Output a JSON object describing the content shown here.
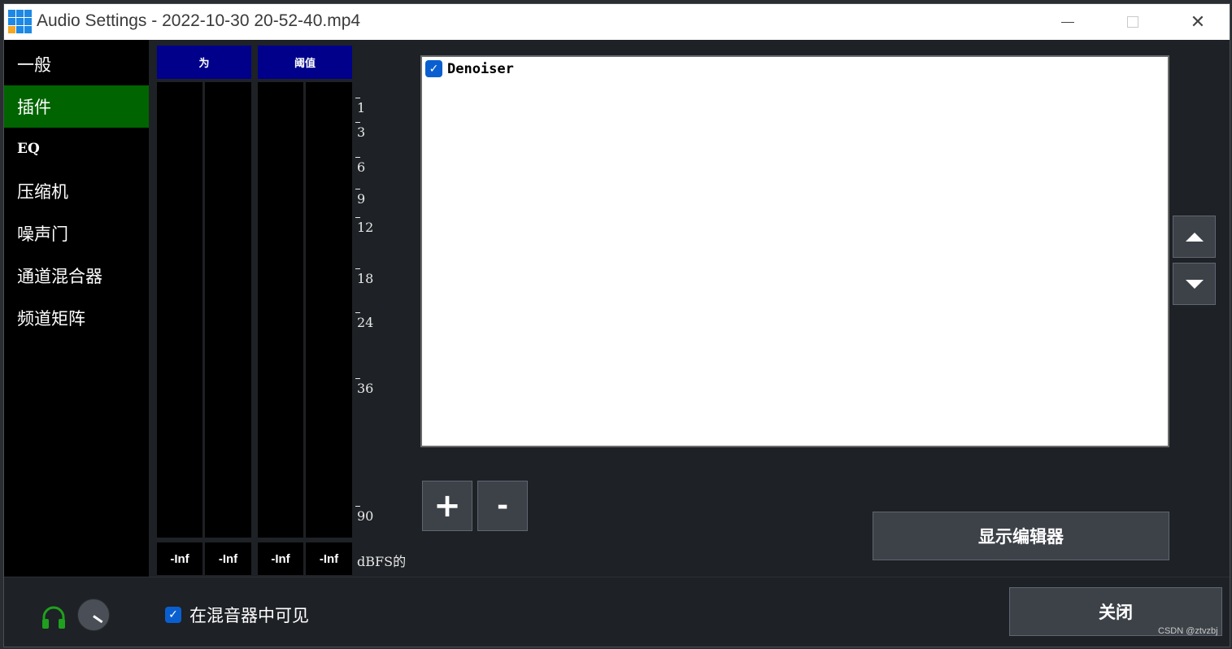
{
  "window": {
    "title": "Audio Settings - 2022-10-30 20-52-40.mp4",
    "close_glyph": "✕"
  },
  "sidebar": {
    "items": [
      {
        "label": "一般"
      },
      {
        "label": "插件",
        "active": true
      },
      {
        "label": "EQ"
      },
      {
        "label": "压缩机"
      },
      {
        "label": "噪声门"
      },
      {
        "label": "通道混合器"
      },
      {
        "label": "频道矩阵"
      }
    ]
  },
  "meters": {
    "channels": [
      {
        "label": "为",
        "values": [
          "-Inf",
          "-Inf"
        ]
      },
      {
        "label": "阈值",
        "values": [
          "-Inf",
          "-Inf"
        ]
      }
    ],
    "scale": [
      "1",
      "3",
      "6",
      "9",
      "12",
      "18",
      "24",
      "36",
      "90"
    ],
    "unit": "dBFS的"
  },
  "plugins": {
    "items": [
      {
        "name": "Denoiser",
        "enabled": true
      }
    ],
    "add_label": "+",
    "remove_label": "-",
    "show_editor_label": "显示编辑器"
  },
  "footer": {
    "visible_in_mixer_label": "在混音器中可见",
    "visible_in_mixer_checked": true,
    "close_label": "关闭",
    "watermark": "CSDN @ztvzbj"
  },
  "colors": {
    "active_item": "#006400",
    "meter_header": "#00008b",
    "checkbox": "#0a5fd0",
    "headphone": "#1fa01f",
    "app_icon": [
      "#1e88e5",
      "#1e88e5",
      "#1e88e5",
      "#1e88e5",
      "#1e88e5",
      "#1e88e5",
      "#f5a623",
      "#1e88e5",
      "#1e88e5"
    ]
  },
  "icons": {
    "app": "app-grid-icon",
    "headphone": "headphone-icon",
    "check": "✓"
  }
}
